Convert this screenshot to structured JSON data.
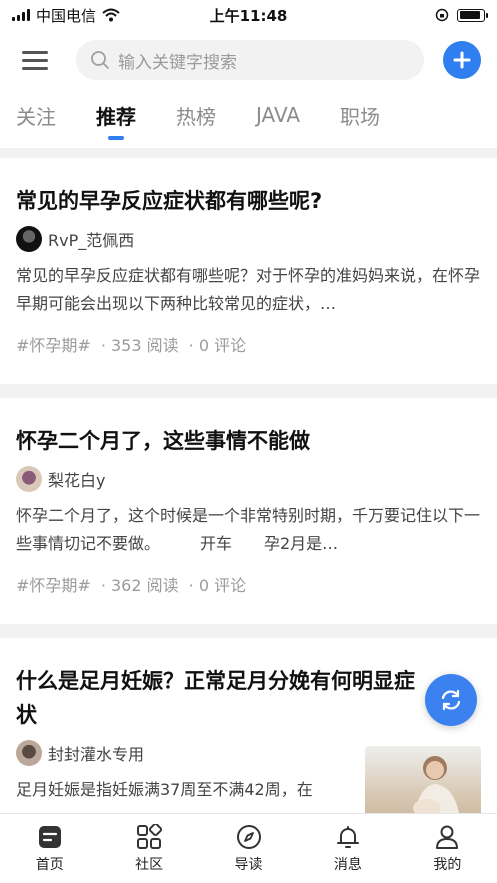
{
  "status_bar": {
    "carrier": "中国电信",
    "time": "上午11:48"
  },
  "header": {
    "search_placeholder": "输入关键字搜索"
  },
  "tabs": [
    {
      "label": "关注",
      "active": false
    },
    {
      "label": "推荐",
      "active": true
    },
    {
      "label": "热榜",
      "active": false
    },
    {
      "label": "JAVA",
      "active": false
    },
    {
      "label": "职场",
      "active": false
    }
  ],
  "posts": [
    {
      "title": "常见的早孕反应症状都有哪些呢?",
      "author": "RvP_范佩西",
      "summary": "常见的早孕反应症状都有哪些呢？对于怀孕的准妈妈来说，在怀孕早期可能会出现以下两种比较常见的症状，…",
      "tag": "#怀孕期#",
      "reads": "· 353 阅读",
      "comments": "· 0 评论"
    },
    {
      "title": "怀孕二个月了，这些事情不能做",
      "author": "梨花白y",
      "summary": "怀孕二个月了，这个时候是一个非常特别时期，千万要记住以下一些事情切记不要做。　　　开车　　孕2月是…",
      "tag": "#怀孕期#",
      "reads": "· 362 阅读",
      "comments": "· 0 评论"
    },
    {
      "title": "什么是足月妊娠？正常足月分娩有何明显症状",
      "author": "封封灌水专用",
      "summary": "足月妊娠是指妊娠满37周至不满42周，在"
    }
  ],
  "bottom_nav": [
    {
      "label": "首页",
      "icon": "home-icon"
    },
    {
      "label": "社区",
      "icon": "community-icon"
    },
    {
      "label": "导读",
      "icon": "compass-icon"
    },
    {
      "label": "消息",
      "icon": "bell-icon"
    },
    {
      "label": "我的",
      "icon": "user-icon"
    }
  ],
  "colors": {
    "accent": "#2f7ff0",
    "fab": "#3b82f0"
  }
}
